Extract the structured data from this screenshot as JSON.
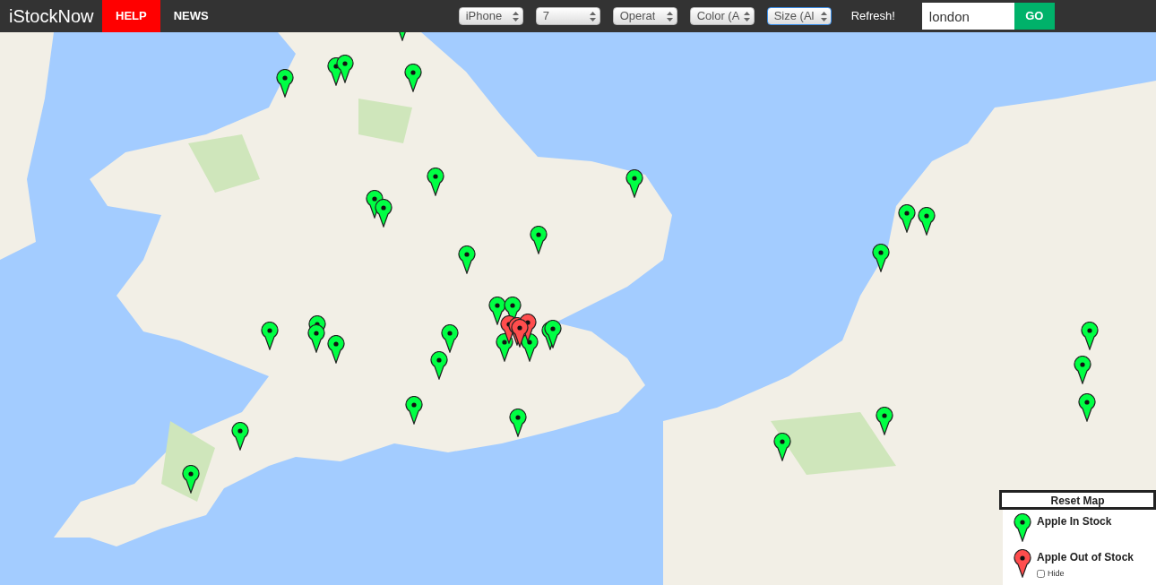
{
  "brand": "iStockNow",
  "nav": [
    {
      "label": "HELP",
      "selected": true
    },
    {
      "label": "NEWS",
      "selected": false
    }
  ],
  "filters": [
    {
      "value": "iPhone",
      "focused": false
    },
    {
      "value": "7",
      "focused": false
    },
    {
      "value": "Operat",
      "focused": false
    },
    {
      "value": "Color (A",
      "focused": false
    },
    {
      "value": "Size (Al",
      "focused": true
    }
  ],
  "refresh": "Refresh!",
  "search": {
    "value": "london"
  },
  "go": "GO",
  "markers": [
    {
      "in_stock": true
    },
    {
      "in_stock": true
    },
    {
      "in_stock": true
    },
    {
      "in_stock": true
    },
    {
      "in_stock": true
    },
    {
      "in_stock": true
    },
    {
      "in_stock": true
    },
    {
      "in_stock": true
    },
    {
      "in_stock": true
    },
    {
      "in_stock": true
    },
    {
      "in_stock": true
    },
    {
      "in_stock": true
    },
    {
      "in_stock": true
    },
    {
      "in_stock": true
    },
    {
      "in_stock": true
    },
    {
      "in_stock": true
    },
    {
      "in_stock": true
    },
    {
      "in_stock": true
    },
    {
      "in_stock": true
    },
    {
      "in_stock": true
    },
    {
      "in_stock": true
    },
    {
      "in_stock": true
    },
    {
      "in_stock": true
    },
    {
      "in_stock": true
    },
    {
      "in_stock": true
    },
    {
      "in_stock": true
    },
    {
      "in_stock": true
    },
    {
      "in_stock": true
    },
    {
      "in_stock": true
    },
    {
      "in_stock": true
    },
    {
      "in_stock": true
    },
    {
      "in_stock": true
    },
    {
      "in_stock": true
    },
    {
      "in_stock": true
    },
    {
      "in_stock": true
    },
    {
      "in_stock": false
    },
    {
      "in_stock": false
    },
    {
      "in_stock": false
    },
    {
      "in_stock": false
    }
  ],
  "reset_button": "Reset Map",
  "legend": [
    {
      "label": "Apple In Stock",
      "in_stock": true
    },
    {
      "label": "Apple Out of Stock",
      "in_stock": false,
      "hide": {
        "label": "Hide",
        "checked": false
      }
    }
  ]
}
